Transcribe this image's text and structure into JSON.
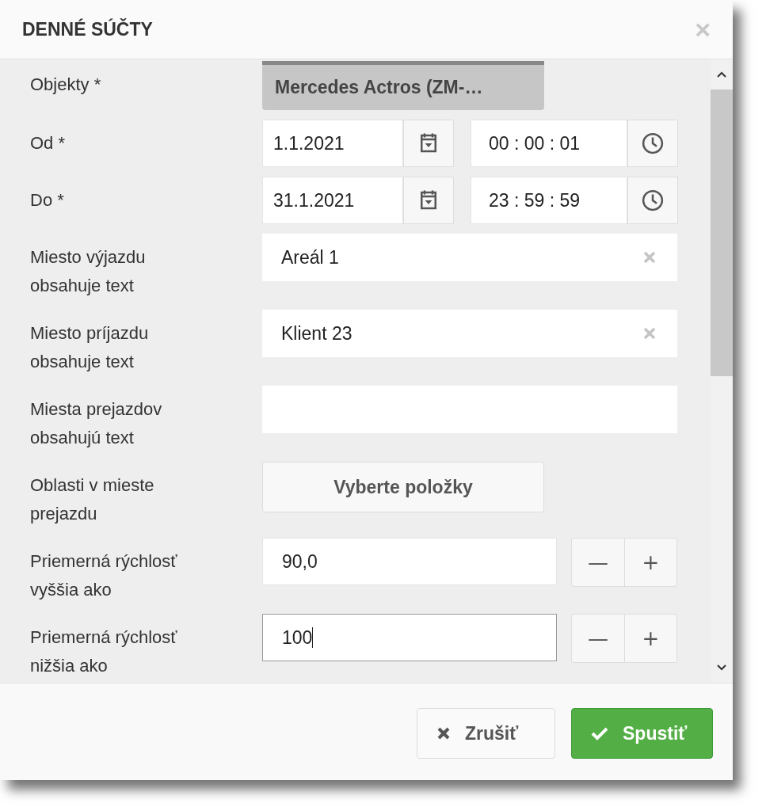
{
  "dialog": {
    "title": "DENNÉ SÚČTY",
    "close": "×"
  },
  "fields": [
    {
      "kind": "select",
      "label": "Objekty *",
      "value": "Mercedes Actros (ZM-…"
    },
    {
      "kind": "datetime",
      "label": "Od *",
      "date": "1.1.2021",
      "time": "00 : 00 : 01"
    },
    {
      "kind": "datetime",
      "label": "Do *",
      "date": "31.1.2021",
      "time": "23 : 59 : 59"
    },
    {
      "kind": "text",
      "label": "Miesto výjazdu obsahuje text",
      "value": "Areál 1",
      "clearable": true
    },
    {
      "kind": "text",
      "label": "Miesto príjazdu obsahuje text",
      "value": "Klient 23",
      "clearable": true
    },
    {
      "kind": "text",
      "label": "Miesta prejazdov obsahujú text",
      "clearable": false
    },
    {
      "kind": "multiselect",
      "label": "Oblasti v mieste prejazdu",
      "value": "Vyberte položky"
    },
    {
      "kind": "number",
      "label": "Priemerná rýchlosť vyššia ako",
      "value": "90,0",
      "focused": false,
      "minus": "—",
      "plus": "+"
    },
    {
      "kind": "number",
      "label": "Priemerná rýchlosť nižšia ako",
      "value": "100",
      "focused": true,
      "minus": "—",
      "plus": "+"
    }
  ],
  "buttons": [
    {
      "kind": "cancel",
      "label": "Zrušiť"
    },
    {
      "kind": "primary",
      "label": "Spustiť"
    }
  ]
}
